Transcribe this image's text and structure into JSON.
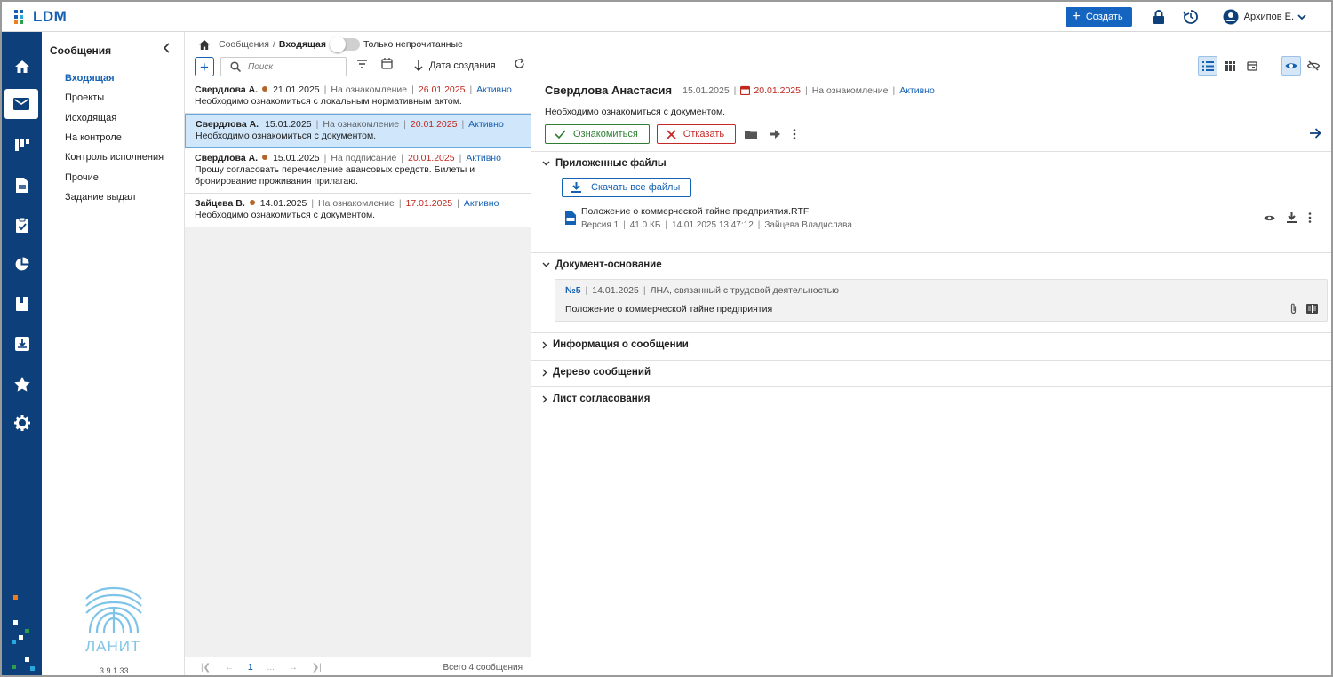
{
  "app": {
    "logo_text": "LDM",
    "create_label": "Создать",
    "user_name": "Архипов Е.",
    "version": "3.9.1.33",
    "brand_text": "ЛАНИТ"
  },
  "section_menu": {
    "title": "Сообщения",
    "items": [
      {
        "label": "Входящая",
        "active": true
      },
      {
        "label": "Проекты"
      },
      {
        "label": "Исходящая"
      },
      {
        "label": "На контроле"
      },
      {
        "label": "Контроль исполнения"
      },
      {
        "label": "Прочие"
      },
      {
        "label": "Задание выдал"
      }
    ]
  },
  "list": {
    "breadcrumb_root": "Сообщения",
    "breadcrumb_sep": "/",
    "breadcrumb_current": "Входящая",
    "unread_toggle_label": "Только непрочитанные",
    "search_placeholder": "Поиск",
    "sort_label": "Дата создания",
    "messages": [
      {
        "author": "Свердлова А.",
        "date": "21.01.2025",
        "type": "На ознакомление",
        "due": "26.01.2025",
        "status": "Активно",
        "text": "Необходимо ознакомиться с локальным нормативным актом."
      },
      {
        "author": "Свердлова А.",
        "date": "15.01.2025",
        "type": "На ознакомление",
        "due": "20.01.2025",
        "status": "Активно",
        "text": "Необходимо ознакомиться с документом."
      },
      {
        "author": "Свердлова А.",
        "date": "15.01.2025",
        "type": "На подписание",
        "due": "20.01.2025",
        "status": "Активно",
        "text": "Прошу согласовать перечисление авансовых средств. Билеты и бронирование проживания прилагаю."
      },
      {
        "author": "Зайцева В.",
        "date": "14.01.2025",
        "type": "На ознакомление",
        "due": "17.01.2025",
        "status": "Активно",
        "text": "Необходимо ознакомиться с документом."
      }
    ],
    "pager_page": "1",
    "pager_more": "...",
    "total": "Всего 4 сообщения"
  },
  "detail": {
    "name": "Свердлова Анастасия",
    "date": "15.01.2025",
    "due": "20.01.2025",
    "type": "На ознакомление",
    "status": "Активно",
    "text": "Необходимо ознакомиться с документом.",
    "accept_label": "Ознакомиться",
    "reject_label": "Отказать",
    "sections": {
      "files_title": "Приложенные файлы",
      "download_all_label": "Скачать все файлы",
      "file_name": "Положение о коммерческой тайне предприятия.RTF",
      "file_version": "Версия 1",
      "file_size": "41.0 КБ",
      "file_time": "14.01.2025 13:47:12",
      "file_author": "Зайцева Владислава",
      "base_title": "Документ-основание",
      "base_number": "№5",
      "base_date": "14.01.2025",
      "base_kind": "ЛНА, связанный с трудовой деятельностью",
      "base_name": "Положение о коммерческой тайне предприятия",
      "info_title": "Информация о сообщении",
      "tree_title": "Дерево сообщений",
      "approval_title": "Лист согласования"
    }
  },
  "colors": {
    "nav_bg": "#0d3f7a",
    "primary": "#1565c0",
    "danger": "#c62828",
    "success": "#2e7d32",
    "selected_row": "#cfe6fb"
  },
  "icons": [
    "home-icon",
    "mail-icon",
    "board-icon",
    "document-icon",
    "clipboard-check-icon",
    "pie-chart-icon",
    "book-icon",
    "archive-icon",
    "star-icon",
    "gear-icon",
    "lock-icon",
    "history-icon",
    "account-icon",
    "search-icon",
    "filter-icon",
    "calendar-icon",
    "refresh-icon",
    "eye-icon",
    "eye-off-icon",
    "download-icon",
    "folder-icon",
    "forward-icon",
    "more-icon",
    "attach-icon"
  ]
}
